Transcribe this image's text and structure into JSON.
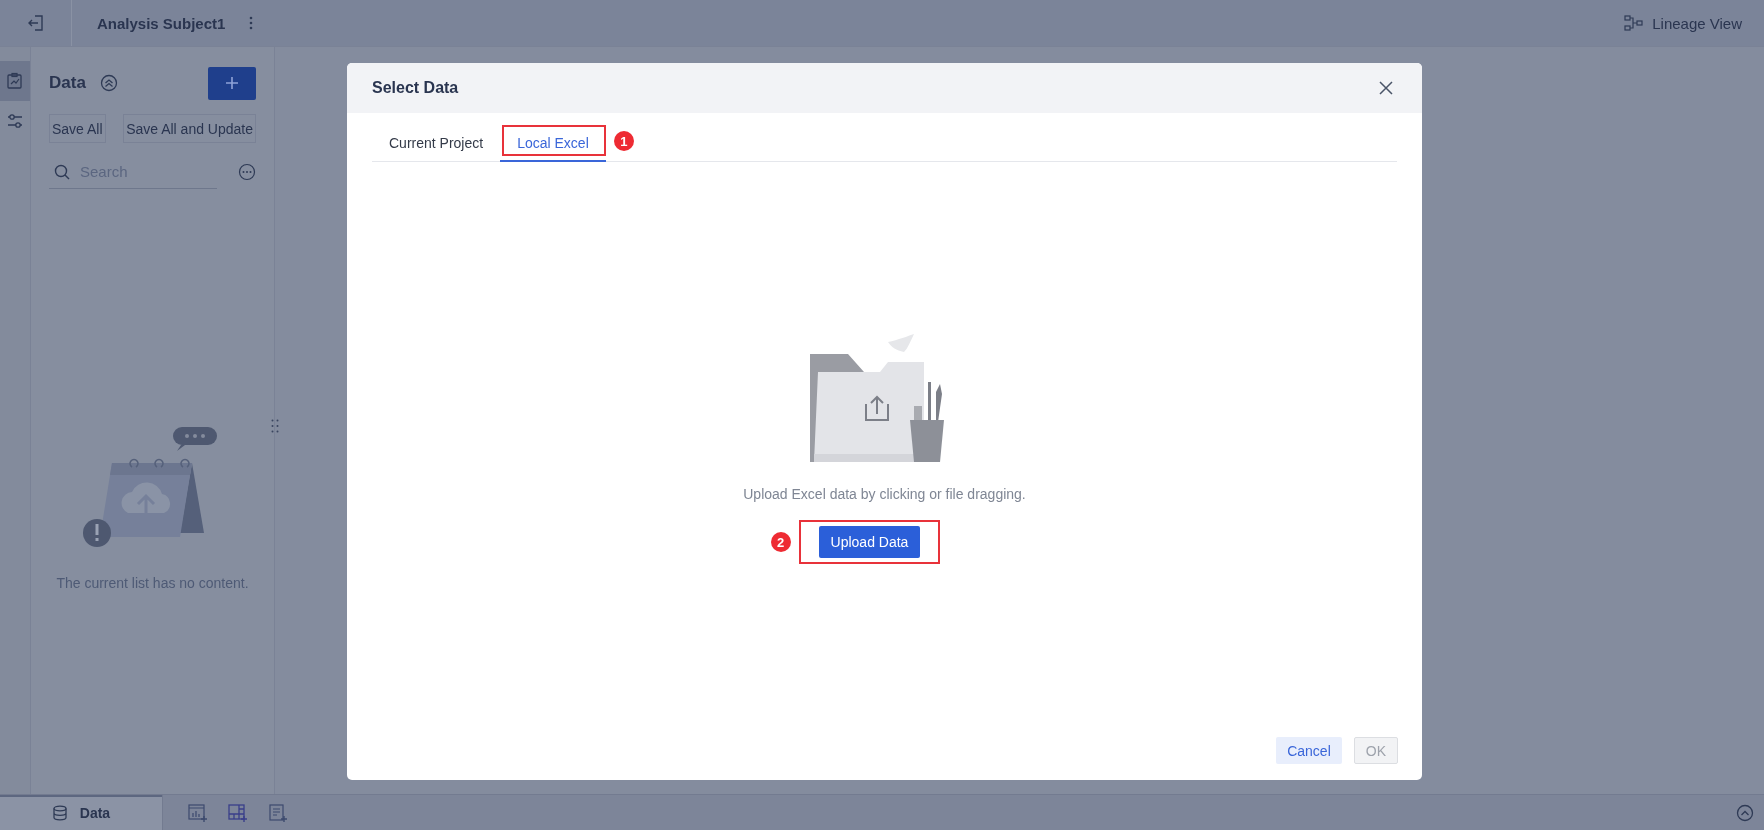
{
  "topbar": {
    "title": "Analysis Subject1",
    "lineage_link": "Lineage View"
  },
  "rail": [
    {
      "kind": "report",
      "selected": true
    },
    {
      "kind": "filter",
      "selected": false
    }
  ],
  "data_panel": {
    "title": "Data",
    "buttons": [
      "Save All",
      "Save All and Update"
    ],
    "search": {
      "placeholder": "Search"
    },
    "empty_text": "The current list has no content."
  },
  "bottom_bar": {
    "tabs": [
      {
        "label": "Data",
        "selected": true
      }
    ]
  },
  "dialog": {
    "title": "Select Data",
    "tabs": [
      {
        "label": "Current Project",
        "selected": false
      },
      {
        "label": "Local Excel",
        "selected": true,
        "callout": "1"
      }
    ],
    "hint": "Upload Excel data by clicking or file dragging.",
    "upload_button": {
      "label": "Upload Data",
      "callout": "2"
    },
    "buttons": [
      {
        "label": "Cancel",
        "disabled": false
      },
      {
        "label": "OK",
        "disabled": true
      }
    ]
  }
}
